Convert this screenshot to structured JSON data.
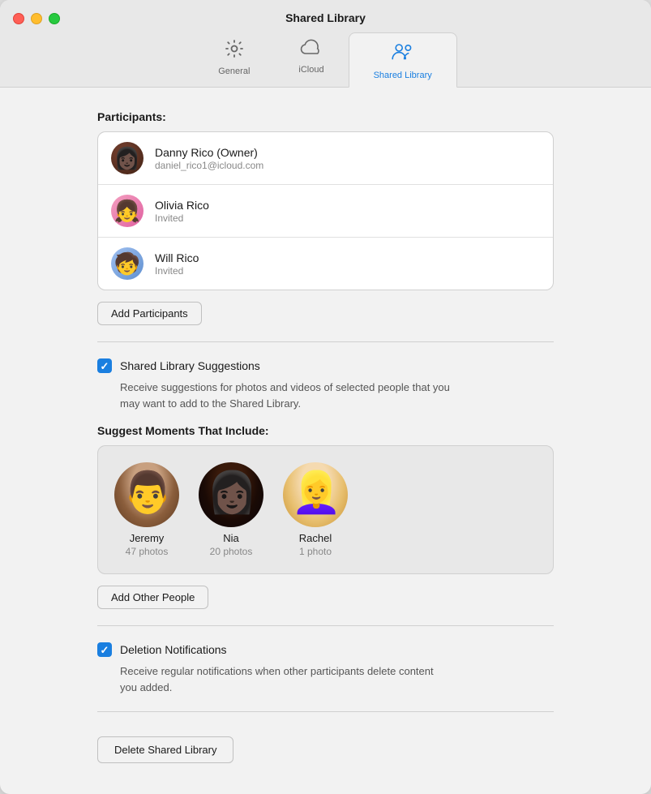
{
  "window": {
    "title": "Shared Library"
  },
  "tabs": [
    {
      "id": "general",
      "label": "General",
      "active": false
    },
    {
      "id": "icloud",
      "label": "iCloud",
      "active": false
    },
    {
      "id": "shared-library",
      "label": "Shared Library",
      "active": true
    }
  ],
  "participants": {
    "section_label": "Participants:",
    "list": [
      {
        "name": "Danny Rico (Owner)",
        "sub": "daniel_rico1@icloud.com",
        "avatar_type": "danny"
      },
      {
        "name": "Olivia Rico",
        "sub": "Invited",
        "avatar_type": "olivia"
      },
      {
        "name": "Will Rico",
        "sub": "Invited",
        "avatar_type": "will"
      }
    ],
    "add_button_label": "Add Participants"
  },
  "suggestions": {
    "checkbox_label": "Shared Library Suggestions",
    "description": "Receive suggestions for photos and videos of selected people that you\nmay want to add to the Shared Library.",
    "suggest_moments_label": "Suggest Moments That Include:",
    "people": [
      {
        "name": "Jeremy",
        "count": "47 photos"
      },
      {
        "name": "Nia",
        "count": "20 photos"
      },
      {
        "name": "Rachel",
        "count": "1 photo"
      }
    ],
    "add_people_button": "Add Other People"
  },
  "deletion_notifications": {
    "checkbox_label": "Deletion Notifications",
    "description": "Receive regular notifications when other participants delete content\nyou added."
  },
  "delete_button_label": "Delete Shared Library",
  "traffic_lights": {
    "close_title": "Close",
    "minimize_title": "Minimize",
    "maximize_title": "Maximize"
  }
}
